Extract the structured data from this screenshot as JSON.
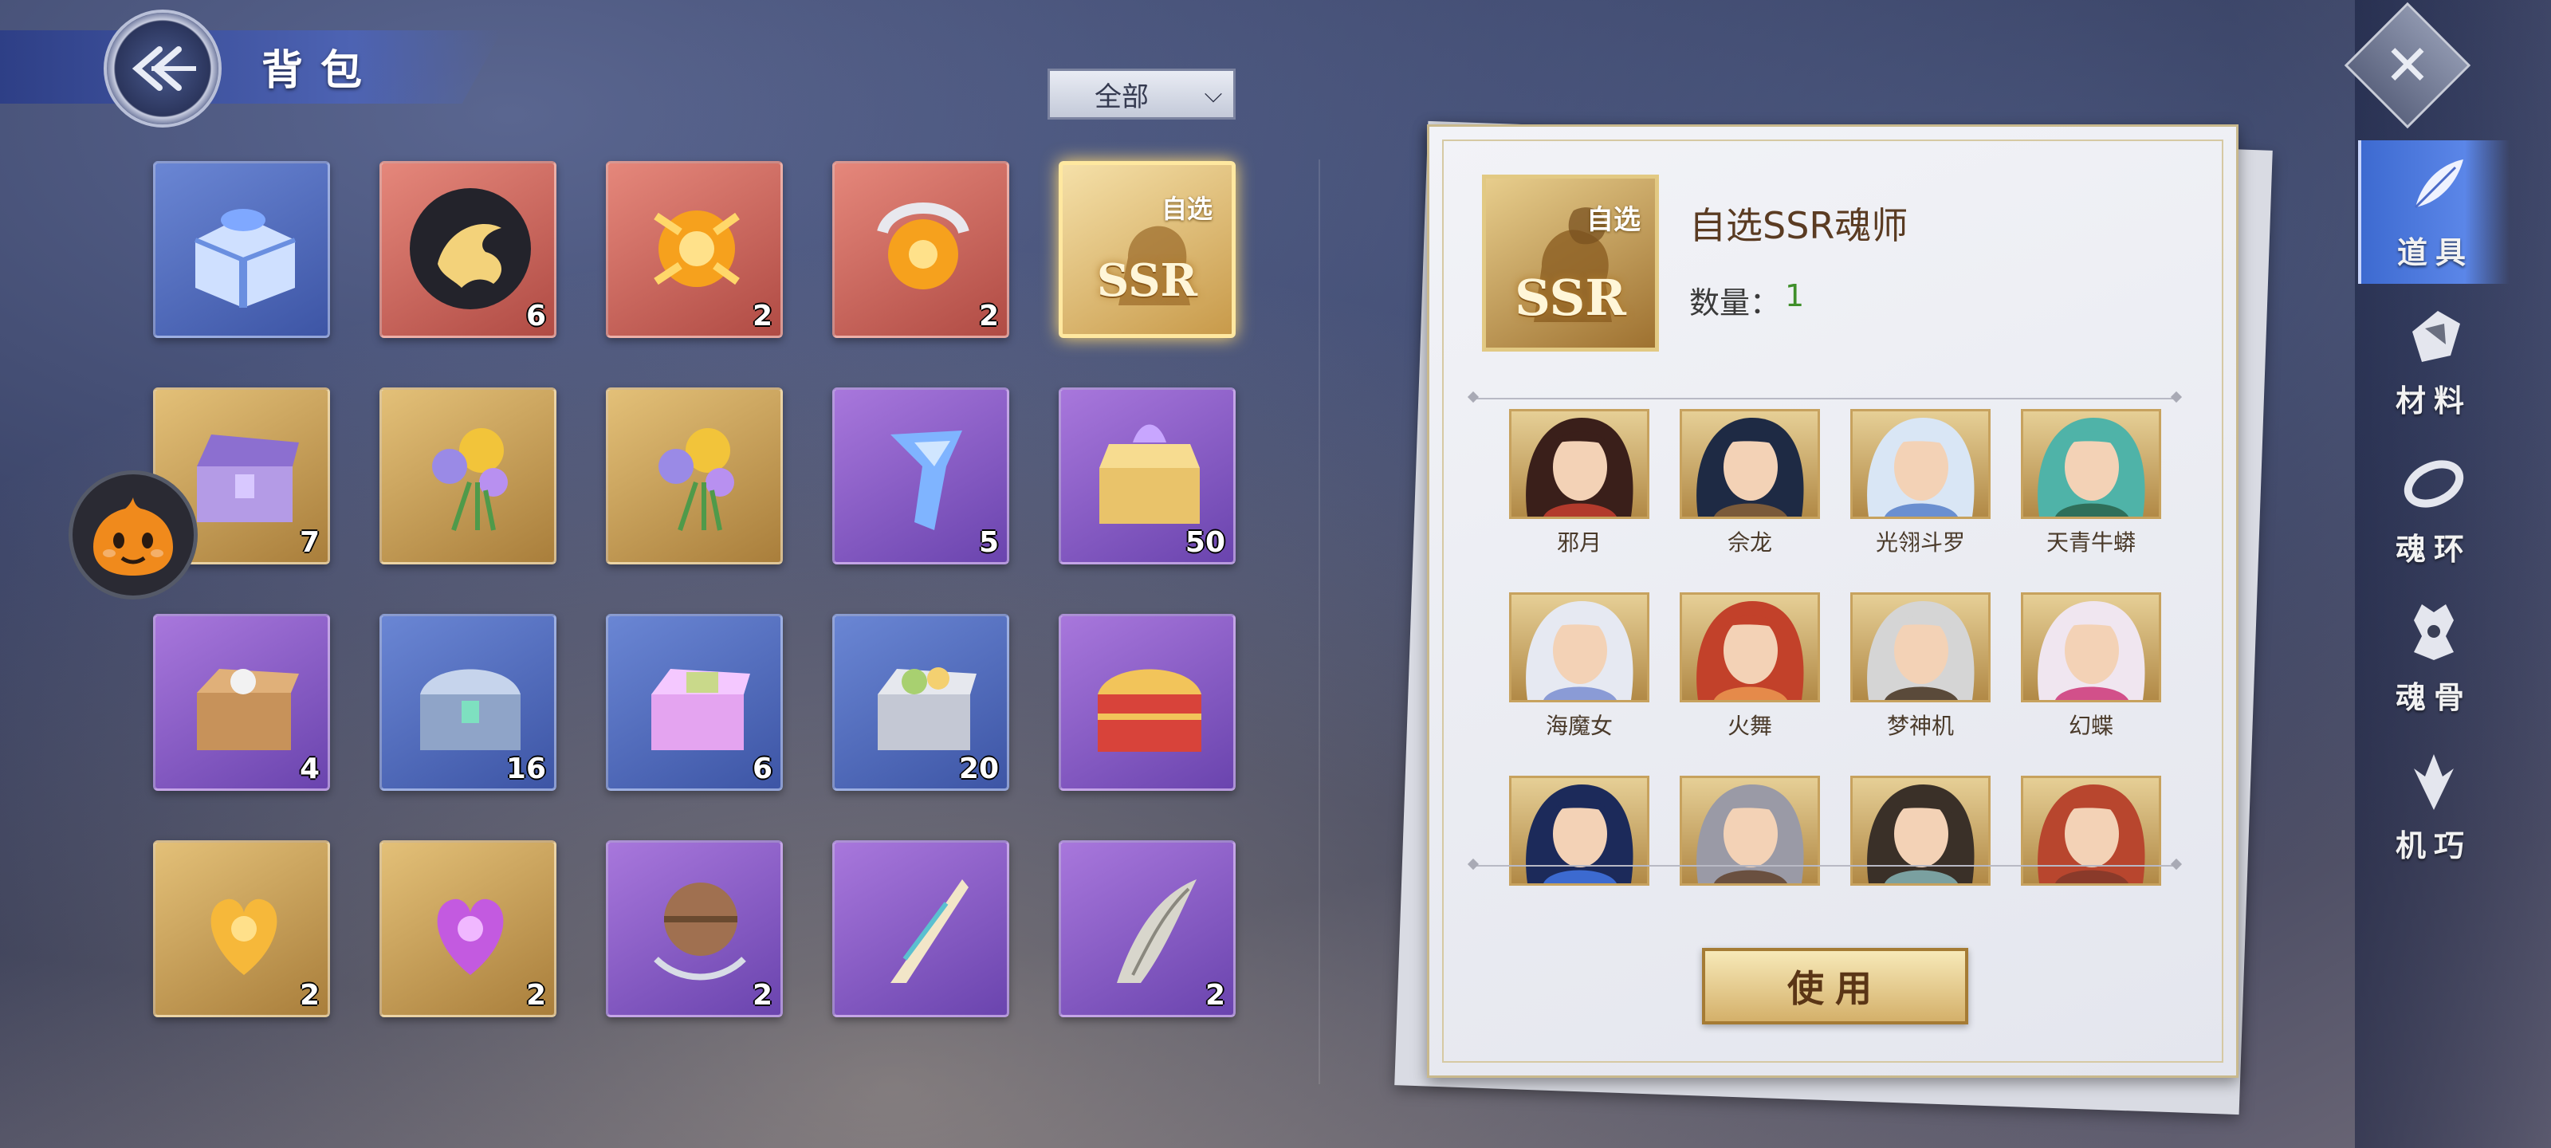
{
  "header": {
    "title": "背包"
  },
  "filter": {
    "selected": "全部"
  },
  "inventory": [
    {
      "icon": "blue-gift-box-icon",
      "quality": "blue",
      "qty": ""
    },
    {
      "icon": "golden-phoenix-emblem-icon",
      "quality": "red",
      "qty": "6"
    },
    {
      "icon": "sun-orb-icon",
      "quality": "red",
      "qty": "2"
    },
    {
      "icon": "crescent-sun-orb-icon",
      "quality": "red",
      "qty": "2"
    },
    {
      "icon": "ssr-selector-icon",
      "quality": "gold-bright",
      "qty": "",
      "badge": "自选",
      "ssr": "SSR"
    },
    {
      "icon": "purple-treasure-chest-icon",
      "quality": "gold",
      "qty": "7"
    },
    {
      "icon": "golden-flower-bouquet-icon",
      "quality": "gold",
      "qty": ""
    },
    {
      "icon": "golden-flower-bouquet-icon",
      "quality": "gold",
      "qty": ""
    },
    {
      "icon": "blue-crystal-shard-icon",
      "quality": "purple",
      "qty": "5"
    },
    {
      "icon": "golden-lotus-chest-icon",
      "quality": "purple",
      "qty": "50"
    },
    {
      "icon": "wooden-supply-box-icon",
      "quality": "purple",
      "qty": "4"
    },
    {
      "icon": "silver-chest-icon",
      "quality": "blue",
      "qty": "16"
    },
    {
      "icon": "pink-gift-box-icon",
      "quality": "blue",
      "qty": "6"
    },
    {
      "icon": "gray-supply-box-icon",
      "quality": "blue",
      "qty": "20"
    },
    {
      "icon": "red-gold-chest-icon",
      "quality": "purple",
      "qty": ""
    },
    {
      "icon": "golden-heart-crest-icon",
      "quality": "gold",
      "qty": "2"
    },
    {
      "icon": "purple-heart-crest-icon",
      "quality": "gold",
      "qty": "2"
    },
    {
      "icon": "bronze-orb-pendant-icon",
      "quality": "purple",
      "qty": "2"
    },
    {
      "icon": "ornate-feather-blade-icon",
      "quality": "purple",
      "qty": ""
    },
    {
      "icon": "beast-fang-icon",
      "quality": "purple",
      "qty": "2"
    }
  ],
  "detail": {
    "icon_badge": "自选",
    "icon_ssr": "SSR",
    "name": "自选SSR魂师",
    "qty_label": "数量：",
    "qty_value": "1",
    "heroes": [
      {
        "name": "邪月",
        "hair": "#3a1f1a",
        "accent": "#b23a2c"
      },
      {
        "name": "佘龙",
        "hair": "#1e2a44",
        "accent": "#7a5a3a"
      },
      {
        "name": "光翎斗罗",
        "hair": "#d9e6f5",
        "accent": "#6a8fd0"
      },
      {
        "name": "天青牛蟒",
        "hair": "#4fb3a8",
        "accent": "#2f6f5a"
      },
      {
        "name": "海魔女",
        "hair": "#e6e9f2",
        "accent": "#8a9bd6"
      },
      {
        "name": "火舞",
        "hair": "#c2412a",
        "accent": "#e58a4a"
      },
      {
        "name": "梦神机",
        "hair": "#d5d5d5",
        "accent": "#5a4a3a"
      },
      {
        "name": "幻蝶",
        "hair": "#f0e6f0",
        "accent": "#d2508a"
      },
      {
        "name": "",
        "hair": "#1c2a5a",
        "accent": "#3c6ad0"
      },
      {
        "name": "",
        "hair": "#9a9aa6",
        "accent": "#6a5040"
      },
      {
        "name": "",
        "hair": "#3a3028",
        "accent": "#7aa0a0"
      },
      {
        "name": "",
        "hair": "#b8462e",
        "accent": "#8a3a2a"
      }
    ],
    "use_label": "使用"
  },
  "tabs": [
    {
      "label": "道具",
      "icon": "feather-icon",
      "active": true
    },
    {
      "label": "材料",
      "icon": "material-crystal-icon",
      "active": false
    },
    {
      "label": "魂环",
      "icon": "soul-ring-icon",
      "active": false
    },
    {
      "label": "魂骨",
      "icon": "soul-bone-icon",
      "active": false
    },
    {
      "label": "机巧",
      "icon": "mechanism-icon",
      "active": false
    }
  ],
  "colors": {
    "accent_blue": "#4d63b3",
    "gold": "#c7a25e",
    "qty_green": "#3f8f2a"
  }
}
